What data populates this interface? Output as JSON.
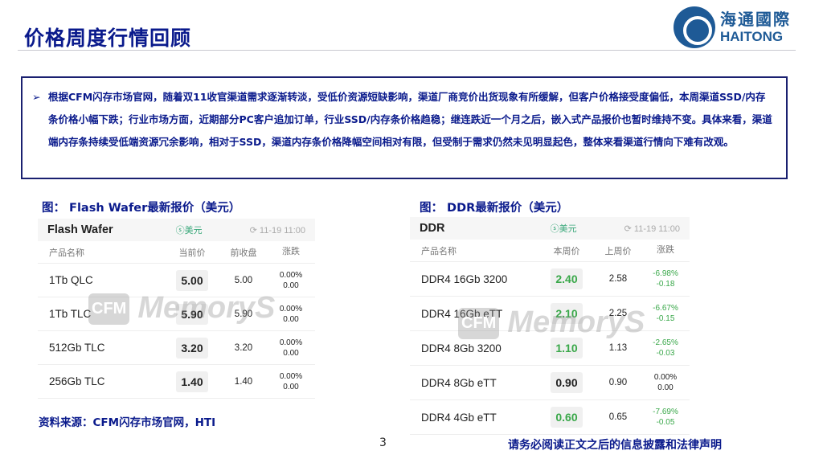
{
  "title": "价格周度行情回顾",
  "logo": {
    "cn": "海通國際",
    "en": "HAITONG"
  },
  "summary": "根据CFM闪存市场官网，随着双11收官渠道需求逐渐转淡，受低价资源短缺影响，渠道厂商竞价出货现象有所缓解，但客户价格接受度偏低，本周渠道SSD/内存条价格小幅下跌；行业市场方面，近期部分PC客户追加订单，行业SSD/内存条价格趋稳；继连跌近一个月之后，嵌入式产品报价也暂时维持不变。具体来看，渠道端内存条持续受低端资源冗余影响，相对于SSD，渠道内存条价格降幅空间相对有限，但受制于需求仍然未见明显起色，整体来看渠道行情向下难有改观。",
  "bullet": "➢",
  "watermark": {
    "box": "CFM",
    "text": "MemoryS"
  },
  "tables": [
    {
      "caption": "图： Flash Wafer最新报价（美元）",
      "name": "Flash Wafer",
      "currency": "ⓢ美元",
      "time": "⟳ 11-19 11:00",
      "headers": [
        "产品名称",
        "当前价",
        "前收盘",
        "涨跌"
      ],
      "rows": [
        {
          "name": "1Tb QLC",
          "price": "5.00",
          "prev": "5.00",
          "pct": "0.00%",
          "chg": "0.00",
          "down": false
        },
        {
          "name": "1Tb TLC",
          "price": "5.90",
          "prev": "5.90",
          "pct": "0.00%",
          "chg": "0.00",
          "down": false
        },
        {
          "name": "512Gb TLC",
          "price": "3.20",
          "prev": "3.20",
          "pct": "0.00%",
          "chg": "0.00",
          "down": false
        },
        {
          "name": "256Gb TLC",
          "price": "1.40",
          "prev": "1.40",
          "pct": "0.00%",
          "chg": "0.00",
          "down": false
        }
      ]
    },
    {
      "caption": "图： DDR最新报价（美元）",
      "name": "DDR",
      "currency": "ⓢ美元",
      "time": "⟳ 11-19 11:00",
      "headers": [
        "产品名称",
        "本周价",
        "上周价",
        "涨跌"
      ],
      "rows": [
        {
          "name": "DDR4 16Gb 3200",
          "price": "2.40",
          "prev": "2.58",
          "pct": "-6.98%",
          "chg": "-0.18",
          "down": true
        },
        {
          "name": "DDR4 16Gb eTT",
          "price": "2.10",
          "prev": "2.25",
          "pct": "-6.67%",
          "chg": "-0.15",
          "down": true
        },
        {
          "name": "DDR4 8Gb 3200",
          "price": "1.10",
          "prev": "1.13",
          "pct": "-2.65%",
          "chg": "-0.03",
          "down": true
        },
        {
          "name": "DDR4 8Gb eTT",
          "price": "0.90",
          "prev": "0.90",
          "pct": "0.00%",
          "chg": "0.00",
          "down": false
        },
        {
          "name": "DDR4 4Gb eTT",
          "price": "0.60",
          "prev": "0.65",
          "pct": "-7.69%",
          "chg": "-0.05",
          "down": true
        }
      ]
    }
  ],
  "source": "资料来源：CFM闪存市场官网，HTI",
  "page_number": "3",
  "disclaimer": "请务必阅读正文之后的信息披露和法律声明",
  "colors": {
    "navy": "#0a1a8c",
    "green": "#3aa84a",
    "logo": "#1e5a96"
  }
}
